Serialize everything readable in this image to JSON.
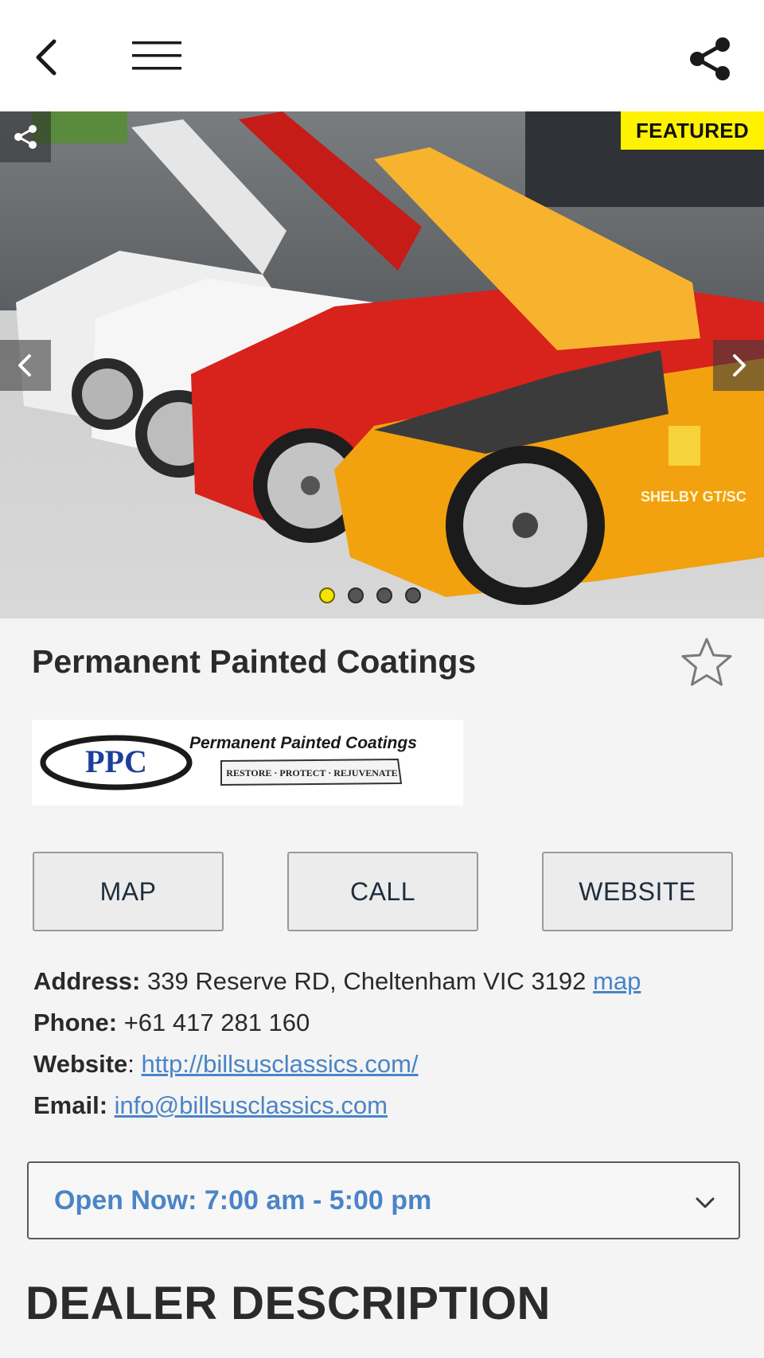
{
  "topbar": {
    "back_icon": "chevron-left-icon",
    "menu_icon": "hamburger-menu-icon",
    "share_icon": "share-icon"
  },
  "carousel": {
    "badge": "FEATURED",
    "slide_count": 4,
    "active_slide": 1,
    "image_text": "SHELBY GT/SC",
    "colors": {
      "badge_bg": "#fff200",
      "active_dot": "#f5e400"
    }
  },
  "listing": {
    "title": "Permanent Painted Coatings",
    "favorite_icon": "star-outline-icon",
    "logo": {
      "acronym": "PPC",
      "name": "Permanent Painted Coatings",
      "tagline": "RESTORE · PROTECT · REJUVENATE"
    }
  },
  "actions": {
    "map": "MAP",
    "call": "CALL",
    "website": "WEBSITE"
  },
  "info": {
    "address_label": "Address:",
    "address_value": "339 Reserve RD, Cheltenham VIC 3192",
    "address_link": "map",
    "phone_label": "Phone:",
    "phone_value": "+61 417 281 160",
    "website_label": "Website",
    "website_sep": ":",
    "website_value": "http://billsusclassics.com/",
    "email_label": "Email:",
    "email_value": "info@billsusclassics.com"
  },
  "hours": {
    "text": "Open Now: 7:00 am - 5:00 pm",
    "color": "#4a84c6"
  },
  "description": {
    "heading": "DEALER DESCRIPTION"
  }
}
